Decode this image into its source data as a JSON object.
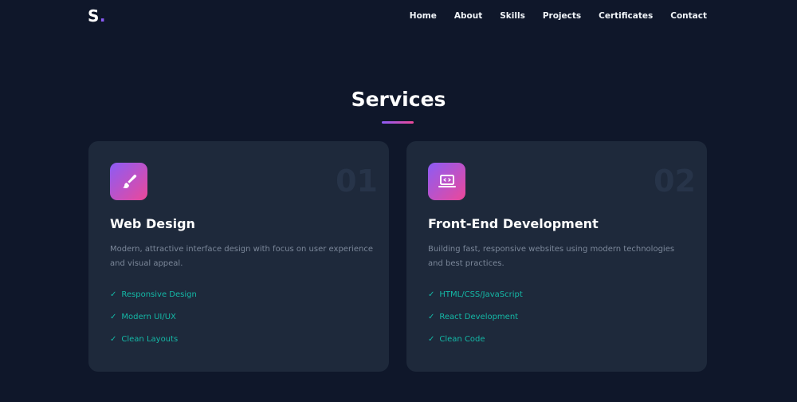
{
  "nav": {
    "logo_letter": "S",
    "logo_dot": ".",
    "links": [
      "Home",
      "About",
      "Skills",
      "Projects",
      "Certificates",
      "Contact"
    ]
  },
  "section": {
    "title": "Services"
  },
  "colors": {
    "background": "#0f172a",
    "card": "#1e293b",
    "accent_start": "#8b5cf6",
    "accent_end": "#ec4899",
    "feature": "#14b8a6"
  },
  "cards": [
    {
      "number": "01",
      "icon": "paintbrush-icon",
      "title": "Web Design",
      "description": "Modern, attractive interface design with focus on user experience and visual appeal.",
      "features": [
        "Responsive Design",
        "Modern UI/UX",
        "Clean Layouts"
      ]
    },
    {
      "number": "02",
      "icon": "code-laptop-icon",
      "title": "Front-End Development",
      "description": "Building fast, responsive websites using modern technologies and best practices.",
      "features": [
        "HTML/CSS/JavaScript",
        "React Development",
        "Clean Code"
      ]
    }
  ],
  "check_glyph": "✓"
}
